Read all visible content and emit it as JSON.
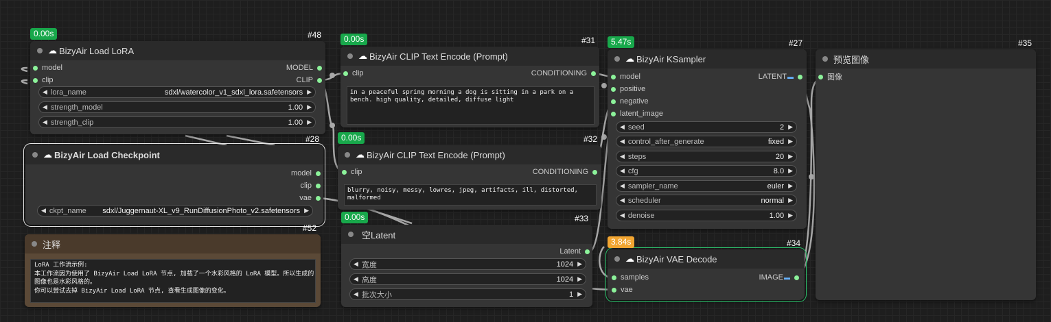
{
  "nodes": {
    "lora": {
      "title": "BizyAir Load LoRA",
      "id": "#48",
      "time": "0.00s",
      "inputs": [
        "model",
        "clip"
      ],
      "outputs": [
        "MODEL",
        "CLIP"
      ],
      "widgets": [
        {
          "label": "lora_name",
          "value": "sdxl/watercolor_v1_sdxl_lora.safetensors"
        },
        {
          "label": "strength_model",
          "value": "1.00"
        },
        {
          "label": "strength_clip",
          "value": "1.00"
        }
      ]
    },
    "checkpoint": {
      "title": "BizyAir Load Checkpoint",
      "id": "#28",
      "outputs": [
        "model",
        "clip",
        "vae"
      ],
      "widgets": [
        {
          "label": "ckpt_name",
          "value": "sdxl/Juggernaut-XL_v9_RunDiffusionPhoto_v2.safetensors"
        }
      ]
    },
    "note": {
      "title": "注释",
      "id": "#52",
      "lines": [
        "LoRA 工作流示例:",
        "本工作流因为使用了 BizyAir Load LoRA 节点, 加载了一个水彩风格的 LoRA 模型。所以生成的",
        "图像也是水彩风格的。",
        "你可以尝试去掉 BizyAir Load LoRA 节点, 查看生成图像的变化。"
      ]
    },
    "clip_pos": {
      "title": "BizyAir CLIP Text Encode (Prompt)",
      "id": "#31",
      "time": "0.00s",
      "input": "clip",
      "output": "CONDITIONING",
      "text": "in a peaceful spring morning a dog is sitting in a park on a bench. high quality, detailed, diffuse light"
    },
    "clip_neg": {
      "title": "BizyAir CLIP Text Encode (Prompt)",
      "id": "#32",
      "time": "0.00s",
      "input": "clip",
      "output": "CONDITIONING",
      "text": "blurry, noisy, messy, lowres, jpeg, artifacts, ill, distorted, malformed"
    },
    "latent": {
      "title": "空Latent",
      "id": "#33",
      "time": "0.00s",
      "output": "Latent",
      "widgets": [
        {
          "label": "宽度",
          "value": "1024"
        },
        {
          "label": "高度",
          "value": "1024"
        },
        {
          "label": "批次大小",
          "value": "1"
        }
      ]
    },
    "ksampler": {
      "title": "BizyAir KSampler",
      "id": "#27",
      "time": "5.47s",
      "inputs": [
        "model",
        "positive",
        "negative",
        "latent_image"
      ],
      "output": "LATENT",
      "widgets": [
        {
          "label": "seed",
          "value": "2"
        },
        {
          "label": "control_after_generate",
          "value": "fixed"
        },
        {
          "label": "steps",
          "value": "20"
        },
        {
          "label": "cfg",
          "value": "8.0"
        },
        {
          "label": "sampler_name",
          "value": "euler"
        },
        {
          "label": "scheduler",
          "value": "normal"
        },
        {
          "label": "denoise",
          "value": "1.00"
        }
      ]
    },
    "vae": {
      "title": "BizyAir VAE Decode",
      "id": "#34",
      "time": "3.84s",
      "inputs": [
        "samples",
        "vae"
      ],
      "output": "IMAGE"
    },
    "preview": {
      "title": "预览图像",
      "id": "#35",
      "input": "图像"
    }
  },
  "icons": {
    "cloud": "cloud-icon",
    "arrow_left": "triangle-left-icon",
    "arrow_right": "triangle-right-icon",
    "image_type": "image-type-icon"
  },
  "colors": {
    "port": "#8cf29a",
    "badge": "#18a84b",
    "badge_running": "#f2a531",
    "wire": "#b0b0b0"
  }
}
